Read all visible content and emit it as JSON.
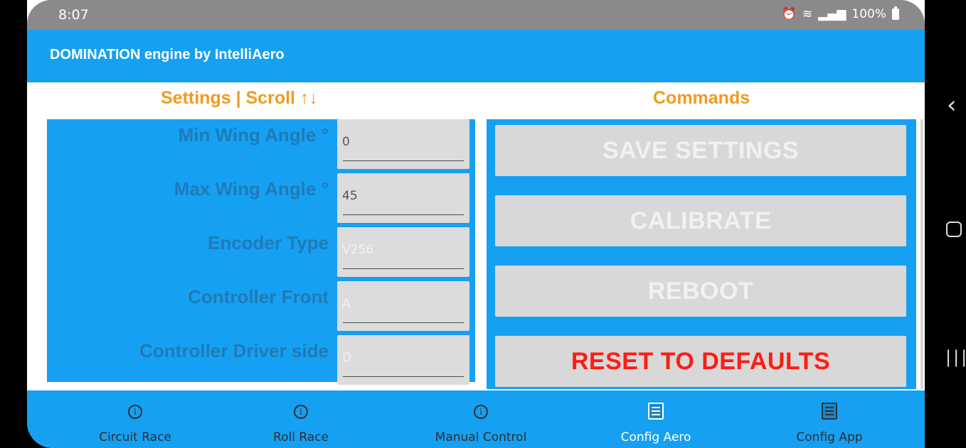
{
  "status_bar": {
    "time": "8:07",
    "indicators": "alarm-icon wifi-icon signal-icon",
    "battery_text": "100%"
  },
  "app_bar": {
    "title": "DOMINATION engine by IntelliAero"
  },
  "settings": {
    "title": "Settings | Scroll ↑↓",
    "fields": [
      {
        "label": "Min Wing Angle °",
        "value": "0"
      },
      {
        "label": "Max Wing Angle °",
        "value": "45"
      },
      {
        "label": "Encoder Type",
        "value": "V256"
      },
      {
        "label": "Controller Front",
        "value": "A"
      },
      {
        "label": "Controller Driver side",
        "value": "D"
      }
    ]
  },
  "commands": {
    "title": "Commands",
    "buttons": [
      {
        "label": "SAVE SETTINGS"
      },
      {
        "label": "CALIBRATE"
      },
      {
        "label": "REBOOT"
      },
      {
        "label": "RESET TO DEFAULTS"
      }
    ]
  },
  "bottom_nav": {
    "items": [
      {
        "label": "Circuit Race",
        "icon": "info-icon"
      },
      {
        "label": "Roll Race",
        "icon": "info-icon"
      },
      {
        "label": "Manual Control",
        "icon": "info-icon"
      },
      {
        "label": "Config Aero",
        "icon": "config-icon",
        "active": true
      },
      {
        "label": "Config App",
        "icon": "config-icon"
      }
    ]
  },
  "colors": {
    "accent": "#16a0f2",
    "section_title": "#f39a1f",
    "reset_button_text": "#ff1c14",
    "settings_label": "#1f7bb8"
  }
}
